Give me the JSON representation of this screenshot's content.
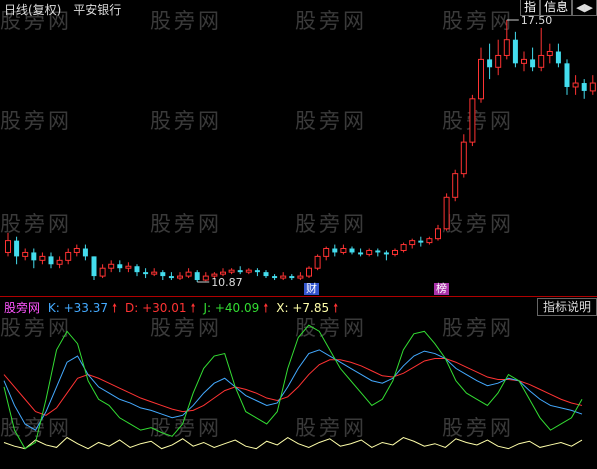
{
  "watermark": "股旁网",
  "header": {
    "period": "日线(复权)",
    "symbol": "平安银行"
  },
  "top_buttons": [
    {
      "label": "指",
      "icon": ""
    },
    {
      "label": "信息",
      "icon": ""
    },
    {
      "label": "",
      "icon": "◀▶"
    }
  ],
  "price_labels": {
    "high": "17.50",
    "low": "10.87"
  },
  "badges": {
    "cai": "财",
    "bang": "榜"
  },
  "indicator": {
    "name": "股旁网",
    "k": "K: +33.37",
    "d": "D: +30.01",
    "j": "J: +40.09",
    "x": "X: +7.85",
    "settings_button": "指标说明",
    "colors": {
      "k": "#44aaff",
      "d": "#ff3333",
      "j": "#33dd33",
      "x": "#ffffaa"
    }
  },
  "colors": {
    "up": "#ff3333",
    "down": "#44ddee",
    "background": "#000000",
    "separator": "#b00000"
  },
  "candles": [
    {
      "o": 11.6,
      "c": 11.9,
      "h": 12.1,
      "l": 11.5
    },
    {
      "o": 11.9,
      "c": 11.5,
      "h": 12.0,
      "l": 11.3
    },
    {
      "o": 11.5,
      "c": 11.6,
      "h": 11.7,
      "l": 11.4
    },
    {
      "o": 11.6,
      "c": 11.4,
      "h": 11.7,
      "l": 11.2
    },
    {
      "o": 11.4,
      "c": 11.5,
      "h": 11.6,
      "l": 11.3
    },
    {
      "o": 11.5,
      "c": 11.3,
      "h": 11.6,
      "l": 11.2
    },
    {
      "o": 11.3,
      "c": 11.4,
      "h": 11.5,
      "l": 11.2
    },
    {
      "o": 11.4,
      "c": 11.6,
      "h": 11.7,
      "l": 11.3
    },
    {
      "o": 11.6,
      "c": 11.7,
      "h": 11.8,
      "l": 11.5
    },
    {
      "o": 11.7,
      "c": 11.5,
      "h": 11.8,
      "l": 11.4
    },
    {
      "o": 11.5,
      "c": 11.0,
      "h": 11.5,
      "l": 10.9
    },
    {
      "o": 11.0,
      "c": 11.2,
      "h": 11.3,
      "l": 10.95
    },
    {
      "o": 11.2,
      "c": 11.3,
      "h": 11.4,
      "l": 11.1
    },
    {
      "o": 11.3,
      "c": 11.2,
      "h": 11.4,
      "l": 11.1
    },
    {
      "o": 11.2,
      "c": 11.25,
      "h": 11.35,
      "l": 11.1
    },
    {
      "o": 11.25,
      "c": 11.1,
      "h": 11.3,
      "l": 11.0
    },
    {
      "o": 11.1,
      "c": 11.05,
      "h": 11.2,
      "l": 10.95
    },
    {
      "o": 11.05,
      "c": 11.1,
      "h": 11.2,
      "l": 11.0
    },
    {
      "o": 11.1,
      "c": 11.0,
      "h": 11.15,
      "l": 10.9
    },
    {
      "o": 11.0,
      "c": 10.95,
      "h": 11.1,
      "l": 10.9
    },
    {
      "o": 10.95,
      "c": 11.0,
      "h": 11.1,
      "l": 10.9
    },
    {
      "o": 11.0,
      "c": 11.1,
      "h": 11.2,
      "l": 10.95
    },
    {
      "o": 11.1,
      "c": 10.9,
      "h": 11.15,
      "l": 10.85
    },
    {
      "o": 10.9,
      "c": 11.0,
      "h": 11.1,
      "l": 10.87
    },
    {
      "o": 11.0,
      "c": 11.05,
      "h": 11.1,
      "l": 10.95
    },
    {
      "o": 11.05,
      "c": 11.1,
      "h": 11.2,
      "l": 11.0
    },
    {
      "o": 11.1,
      "c": 11.15,
      "h": 11.2,
      "l": 11.05
    },
    {
      "o": 11.15,
      "c": 11.1,
      "h": 11.25,
      "l": 11.05
    },
    {
      "o": 11.1,
      "c": 11.15,
      "h": 11.2,
      "l": 11.05
    },
    {
      "o": 11.15,
      "c": 11.1,
      "h": 11.2,
      "l": 11.0
    },
    {
      "o": 11.1,
      "c": 11.0,
      "h": 11.15,
      "l": 10.95
    },
    {
      "o": 11.0,
      "c": 10.95,
      "h": 11.05,
      "l": 10.9
    },
    {
      "o": 10.95,
      "c": 11.0,
      "h": 11.1,
      "l": 10.9
    },
    {
      "o": 11.0,
      "c": 10.95,
      "h": 11.05,
      "l": 10.9
    },
    {
      "o": 10.95,
      "c": 11.0,
      "h": 11.1,
      "l": 10.9
    },
    {
      "o": 11.0,
      "c": 11.2,
      "h": 11.25,
      "l": 10.95
    },
    {
      "o": 11.2,
      "c": 11.5,
      "h": 11.55,
      "l": 11.15
    },
    {
      "o": 11.5,
      "c": 11.7,
      "h": 11.75,
      "l": 11.4
    },
    {
      "o": 11.7,
      "c": 11.6,
      "h": 11.8,
      "l": 11.5
    },
    {
      "o": 11.6,
      "c": 11.7,
      "h": 11.8,
      "l": 11.55
    },
    {
      "o": 11.7,
      "c": 11.6,
      "h": 11.75,
      "l": 11.55
    },
    {
      "o": 11.6,
      "c": 11.55,
      "h": 11.7,
      "l": 11.5
    },
    {
      "o": 11.55,
      "c": 11.65,
      "h": 11.7,
      "l": 11.5
    },
    {
      "o": 11.65,
      "c": 11.6,
      "h": 11.7,
      "l": 11.5
    },
    {
      "o": 11.6,
      "c": 11.55,
      "h": 11.65,
      "l": 11.4
    },
    {
      "o": 11.55,
      "c": 11.65,
      "h": 11.7,
      "l": 11.5
    },
    {
      "o": 11.65,
      "c": 11.8,
      "h": 11.85,
      "l": 11.6
    },
    {
      "o": 11.8,
      "c": 11.9,
      "h": 11.95,
      "l": 11.7
    },
    {
      "o": 11.9,
      "c": 11.85,
      "h": 12.0,
      "l": 11.75
    },
    {
      "o": 11.85,
      "c": 11.95,
      "h": 12.0,
      "l": 11.8
    },
    {
      "o": 11.95,
      "c": 12.2,
      "h": 12.3,
      "l": 11.9
    },
    {
      "o": 12.2,
      "c": 13.0,
      "h": 13.1,
      "l": 12.15
    },
    {
      "o": 13.0,
      "c": 13.6,
      "h": 13.7,
      "l": 12.9
    },
    {
      "o": 13.6,
      "c": 14.4,
      "h": 14.6,
      "l": 13.5
    },
    {
      "o": 14.4,
      "c": 15.5,
      "h": 15.6,
      "l": 14.3
    },
    {
      "o": 15.5,
      "c": 16.5,
      "h": 16.8,
      "l": 15.4
    },
    {
      "o": 16.5,
      "c": 16.3,
      "h": 16.9,
      "l": 16.0
    },
    {
      "o": 16.3,
      "c": 16.6,
      "h": 17.0,
      "l": 16.1
    },
    {
      "o": 16.6,
      "c": 17.0,
      "h": 17.5,
      "l": 16.5
    },
    {
      "o": 17.0,
      "c": 16.4,
      "h": 17.2,
      "l": 16.3
    },
    {
      "o": 16.4,
      "c": 16.5,
      "h": 16.7,
      "l": 16.2
    },
    {
      "o": 16.5,
      "c": 16.3,
      "h": 16.8,
      "l": 16.2
    },
    {
      "o": 16.3,
      "c": 16.6,
      "h": 17.3,
      "l": 16.2
    },
    {
      "o": 16.6,
      "c": 16.7,
      "h": 16.9,
      "l": 16.4
    },
    {
      "o": 16.7,
      "c": 16.4,
      "h": 16.9,
      "l": 16.3
    },
    {
      "o": 16.4,
      "c": 15.8,
      "h": 16.5,
      "l": 15.6
    },
    {
      "o": 15.8,
      "c": 15.9,
      "h": 16.1,
      "l": 15.6
    },
    {
      "o": 15.9,
      "c": 15.7,
      "h": 16.0,
      "l": 15.5
    },
    {
      "o": 15.7,
      "c": 15.9,
      "h": 16.1,
      "l": 15.6
    }
  ],
  "ind_series": {
    "k": [
      60,
      40,
      25,
      20,
      35,
      55,
      75,
      80,
      65,
      55,
      50,
      45,
      42,
      38,
      36,
      33,
      30,
      32,
      40,
      50,
      58,
      62,
      55,
      48,
      44,
      40,
      42,
      55,
      70,
      82,
      85,
      80,
      75,
      70,
      65,
      60,
      58,
      62,
      72,
      80,
      84,
      82,
      78,
      70,
      65,
      60,
      56,
      58,
      62,
      60,
      52,
      45,
      40,
      38,
      36,
      33
    ],
    "d": [
      65,
      55,
      45,
      35,
      32,
      38,
      50,
      62,
      65,
      62,
      58,
      54,
      50,
      46,
      43,
      40,
      37,
      35,
      36,
      40,
      46,
      52,
      55,
      53,
      50,
      46,
      44,
      47,
      55,
      65,
      73,
      77,
      77,
      75,
      72,
      68,
      64,
      63,
      66,
      71,
      76,
      78,
      78,
      75,
      71,
      67,
      63,
      61,
      61,
      60,
      57,
      53,
      49,
      45,
      42,
      40
    ],
    "j": [
      55,
      20,
      5,
      10,
      45,
      85,
      100,
      90,
      60,
      45,
      40,
      30,
      25,
      20,
      22,
      18,
      15,
      25,
      50,
      70,
      80,
      82,
      55,
      35,
      30,
      25,
      35,
      70,
      95,
      105,
      100,
      85,
      70,
      60,
      50,
      40,
      45,
      60,
      85,
      98,
      100,
      90,
      78,
      60,
      50,
      45,
      40,
      50,
      65,
      60,
      45,
      30,
      20,
      25,
      30,
      45
    ],
    "x": [
      10,
      7,
      5,
      12,
      8,
      6,
      14,
      9,
      5,
      10,
      7,
      12,
      6,
      9,
      11,
      5,
      8,
      13,
      7,
      10,
      6,
      9,
      12,
      7,
      5,
      11,
      8,
      14,
      9,
      6,
      10,
      13,
      7,
      9,
      12,
      6,
      10,
      8,
      14,
      11,
      7,
      9,
      6,
      13,
      10,
      8,
      12,
      7,
      5,
      9,
      11,
      6,
      8,
      10,
      7,
      12
    ]
  }
}
